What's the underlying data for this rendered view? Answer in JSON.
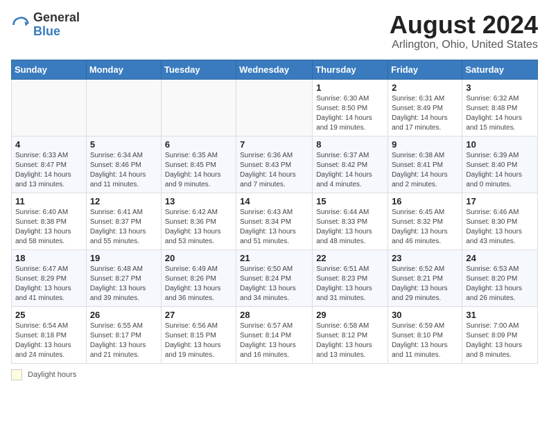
{
  "logo": {
    "general": "General",
    "blue": "Blue"
  },
  "title": "August 2024",
  "subtitle": "Arlington, Ohio, United States",
  "days_of_week": [
    "Sunday",
    "Monday",
    "Tuesday",
    "Wednesday",
    "Thursday",
    "Friday",
    "Saturday"
  ],
  "weeks": [
    [
      {
        "day": "",
        "info": ""
      },
      {
        "day": "",
        "info": ""
      },
      {
        "day": "",
        "info": ""
      },
      {
        "day": "",
        "info": ""
      },
      {
        "day": "1",
        "info": "Sunrise: 6:30 AM\nSunset: 8:50 PM\nDaylight: 14 hours\nand 19 minutes."
      },
      {
        "day": "2",
        "info": "Sunrise: 6:31 AM\nSunset: 8:49 PM\nDaylight: 14 hours\nand 17 minutes."
      },
      {
        "day": "3",
        "info": "Sunrise: 6:32 AM\nSunset: 8:48 PM\nDaylight: 14 hours\nand 15 minutes."
      }
    ],
    [
      {
        "day": "4",
        "info": "Sunrise: 6:33 AM\nSunset: 8:47 PM\nDaylight: 14 hours\nand 13 minutes."
      },
      {
        "day": "5",
        "info": "Sunrise: 6:34 AM\nSunset: 8:46 PM\nDaylight: 14 hours\nand 11 minutes."
      },
      {
        "day": "6",
        "info": "Sunrise: 6:35 AM\nSunset: 8:45 PM\nDaylight: 14 hours\nand 9 minutes."
      },
      {
        "day": "7",
        "info": "Sunrise: 6:36 AM\nSunset: 8:43 PM\nDaylight: 14 hours\nand 7 minutes."
      },
      {
        "day": "8",
        "info": "Sunrise: 6:37 AM\nSunset: 8:42 PM\nDaylight: 14 hours\nand 4 minutes."
      },
      {
        "day": "9",
        "info": "Sunrise: 6:38 AM\nSunset: 8:41 PM\nDaylight: 14 hours\nand 2 minutes."
      },
      {
        "day": "10",
        "info": "Sunrise: 6:39 AM\nSunset: 8:40 PM\nDaylight: 14 hours\nand 0 minutes."
      }
    ],
    [
      {
        "day": "11",
        "info": "Sunrise: 6:40 AM\nSunset: 8:38 PM\nDaylight: 13 hours\nand 58 minutes."
      },
      {
        "day": "12",
        "info": "Sunrise: 6:41 AM\nSunset: 8:37 PM\nDaylight: 13 hours\nand 55 minutes."
      },
      {
        "day": "13",
        "info": "Sunrise: 6:42 AM\nSunset: 8:36 PM\nDaylight: 13 hours\nand 53 minutes."
      },
      {
        "day": "14",
        "info": "Sunrise: 6:43 AM\nSunset: 8:34 PM\nDaylight: 13 hours\nand 51 minutes."
      },
      {
        "day": "15",
        "info": "Sunrise: 6:44 AM\nSunset: 8:33 PM\nDaylight: 13 hours\nand 48 minutes."
      },
      {
        "day": "16",
        "info": "Sunrise: 6:45 AM\nSunset: 8:32 PM\nDaylight: 13 hours\nand 46 minutes."
      },
      {
        "day": "17",
        "info": "Sunrise: 6:46 AM\nSunset: 8:30 PM\nDaylight: 13 hours\nand 43 minutes."
      }
    ],
    [
      {
        "day": "18",
        "info": "Sunrise: 6:47 AM\nSunset: 8:29 PM\nDaylight: 13 hours\nand 41 minutes."
      },
      {
        "day": "19",
        "info": "Sunrise: 6:48 AM\nSunset: 8:27 PM\nDaylight: 13 hours\nand 39 minutes."
      },
      {
        "day": "20",
        "info": "Sunrise: 6:49 AM\nSunset: 8:26 PM\nDaylight: 13 hours\nand 36 minutes."
      },
      {
        "day": "21",
        "info": "Sunrise: 6:50 AM\nSunset: 8:24 PM\nDaylight: 13 hours\nand 34 minutes."
      },
      {
        "day": "22",
        "info": "Sunrise: 6:51 AM\nSunset: 8:23 PM\nDaylight: 13 hours\nand 31 minutes."
      },
      {
        "day": "23",
        "info": "Sunrise: 6:52 AM\nSunset: 8:21 PM\nDaylight: 13 hours\nand 29 minutes."
      },
      {
        "day": "24",
        "info": "Sunrise: 6:53 AM\nSunset: 8:20 PM\nDaylight: 13 hours\nand 26 minutes."
      }
    ],
    [
      {
        "day": "25",
        "info": "Sunrise: 6:54 AM\nSunset: 8:18 PM\nDaylight: 13 hours\nand 24 minutes."
      },
      {
        "day": "26",
        "info": "Sunrise: 6:55 AM\nSunset: 8:17 PM\nDaylight: 13 hours\nand 21 minutes."
      },
      {
        "day": "27",
        "info": "Sunrise: 6:56 AM\nSunset: 8:15 PM\nDaylight: 13 hours\nand 19 minutes."
      },
      {
        "day": "28",
        "info": "Sunrise: 6:57 AM\nSunset: 8:14 PM\nDaylight: 13 hours\nand 16 minutes."
      },
      {
        "day": "29",
        "info": "Sunrise: 6:58 AM\nSunset: 8:12 PM\nDaylight: 13 hours\nand 13 minutes."
      },
      {
        "day": "30",
        "info": "Sunrise: 6:59 AM\nSunset: 8:10 PM\nDaylight: 13 hours\nand 11 minutes."
      },
      {
        "day": "31",
        "info": "Sunrise: 7:00 AM\nSunset: 8:09 PM\nDaylight: 13 hours\nand 8 minutes."
      }
    ]
  ],
  "legend_label": "Daylight hours"
}
